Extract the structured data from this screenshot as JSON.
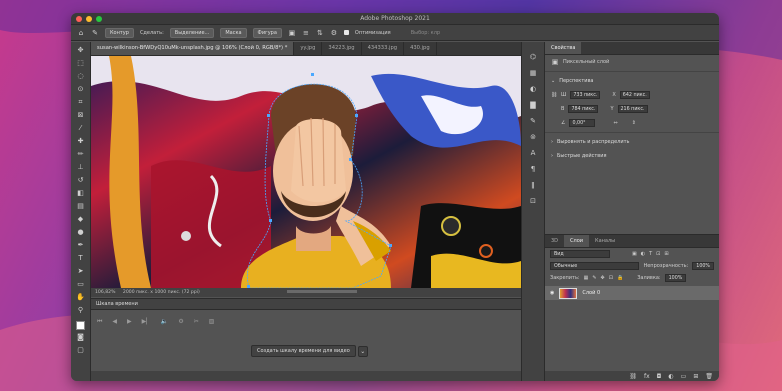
{
  "window": {
    "title": "Adobe Photoshop 2021"
  },
  "options_bar": {
    "mode": "Контур",
    "make_label": "Сделать:",
    "selection_btn": "Выделение...",
    "mask_btn": "Маска",
    "shape_btn": "Фигура",
    "optimize_label": "Оптимизация",
    "search_placeholder": "Выбор: клр"
  },
  "tabs": [
    {
      "label": "susan-wilkinson-BfWDyQ10uMk-unsplash.jpg @ 106% (Слой 0, RGB/8*) *",
      "active": true
    },
    {
      "label": "yy.jpg",
      "active": false
    },
    {
      "label": "34223.jpg",
      "active": false
    },
    {
      "label": "434333.jpg",
      "active": false
    },
    {
      "label": "430.jpg",
      "active": false
    }
  ],
  "status": {
    "zoom": "106,82%",
    "size": "2000 пикс. x 1000 пикс. (72 ppi)"
  },
  "timeline": {
    "title": "Шкала времени",
    "create_btn": "Создать шкалу времени для видео"
  },
  "properties": {
    "tab": "Свойства",
    "layer_type": "Пиксельный слой",
    "transform_title": "Перспектива",
    "w_label": "Ш",
    "w_value": "733 пикс.",
    "h_label": "В",
    "h_value": "784 пикс.",
    "x_label": "X",
    "x_value": "642 пикс.",
    "y_label": "Y",
    "y_value": "216 пикс.",
    "angle_value": "0,00°",
    "align_section": "Выровнять и распределить",
    "quick_actions": "Быстрые действия"
  },
  "layers_panel": {
    "tabs": [
      "3D",
      "Слои",
      "Каналы"
    ],
    "active_tab": "Слои",
    "filter": "Вид",
    "blend_mode": "Обычные",
    "opacity_label": "Непрозрачность:",
    "opacity_value": "100%",
    "lock_label": "Закрепить:",
    "fill_label": "Заливка:",
    "fill_value": "100%",
    "layers": [
      {
        "name": "Слой 0",
        "visible": true
      }
    ]
  },
  "colors": {
    "panel": "#535353",
    "panel_dark": "#424242",
    "header": "#383838"
  }
}
